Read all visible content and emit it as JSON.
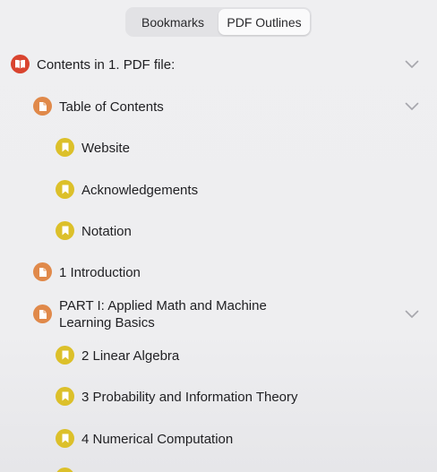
{
  "tabs": {
    "bookmarks": "Bookmarks",
    "outlines": "PDF Outlines",
    "active": "outlines"
  },
  "colors": {
    "book": "#d9442f",
    "page": "#e0894a",
    "bookmark": "#dcc02a"
  },
  "outline": [
    {
      "label": "Contents in 1. PDF file:",
      "icon": "book-icon",
      "expanded": true
    },
    {
      "label": "Table of Contents",
      "icon": "page-icon",
      "expanded": true
    },
    {
      "label": "Website",
      "icon": "bookmark-icon"
    },
    {
      "label": "Acknowledgements",
      "icon": "bookmark-icon"
    },
    {
      "label": "Notation",
      "icon": "bookmark-icon"
    },
    {
      "label": "1 Introduction",
      "icon": "page-icon"
    },
    {
      "label": "PART I: Applied Math and Machine\nLearning Basics",
      "icon": "page-icon",
      "expanded": true
    },
    {
      "label": "2 Linear Algebra",
      "icon": "bookmark-icon"
    },
    {
      "label": "3 Probability and Information Theory",
      "icon": "bookmark-icon"
    },
    {
      "label": "4 Numerical Computation",
      "icon": "bookmark-icon"
    },
    {
      "label": "",
      "icon": "bookmark-icon"
    }
  ]
}
